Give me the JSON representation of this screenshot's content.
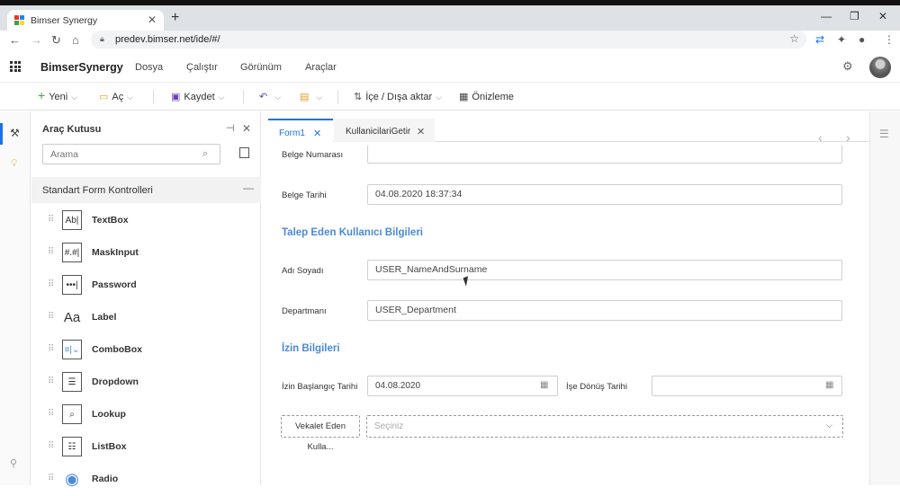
{
  "browser": {
    "tab_title": "Bimser Synergy",
    "url": "predev.bimser.net/ide/#/"
  },
  "app": {
    "brand": "BimserSynergy",
    "menu": [
      "Dosya",
      "Çalıştır",
      "Görünüm",
      "Araçlar"
    ]
  },
  "toolbar": {
    "new_label": "Yeni",
    "open_label": "Aç",
    "save_label": "Kaydet",
    "import_export_label": "İçe / Dışa aktar",
    "preview_label": "Önizleme"
  },
  "toolbox": {
    "title": "Araç Kutusu",
    "search_placeholder": "Arama",
    "section_title": "Standart Form Kontrolleri",
    "items": [
      {
        "name": "TextBox",
        "icon": "textbox-icon",
        "glyph": "Ab|"
      },
      {
        "name": "MaskInput",
        "icon": "maskinput-icon",
        "glyph": "#.#|"
      },
      {
        "name": "Password",
        "icon": "password-icon",
        "glyph": "•••|"
      },
      {
        "name": "Label",
        "icon": "label-icon",
        "glyph": "Aa"
      },
      {
        "name": "ComboBox",
        "icon": "combobox-icon",
        "glyph": "≡|⌄"
      },
      {
        "name": "Dropdown",
        "icon": "dropdown-icon",
        "glyph": "☰"
      },
      {
        "name": "Lookup",
        "icon": "lookup-icon",
        "glyph": "⌕"
      },
      {
        "name": "ListBox",
        "icon": "listbox-icon",
        "glyph": "☷"
      },
      {
        "name": "Radio",
        "icon": "radio-icon",
        "glyph": "◉"
      }
    ]
  },
  "editor": {
    "tabs": [
      {
        "label": "Form1"
      },
      {
        "label": "KullanicilariGetir"
      }
    ],
    "fields": {
      "belge_numarasi": {
        "label": "Belge Numarası",
        "value": ""
      },
      "belge_tarihi": {
        "label": "Belge Tarihi",
        "value": "04.08.2020 18:37:34"
      },
      "section_talep": "Talep Eden Kullanıcı Bilgileri",
      "adi_soyadi": {
        "label": "Adı Soyadı",
        "value": "USER_NameAndSurname"
      },
      "departmani": {
        "label": "Departmanı",
        "value": "USER_Department"
      },
      "section_izin": "İzin Bilgileri",
      "izin_baslangic": {
        "label": "İzin Başlangıç Tarihi",
        "value": "04.08.2020"
      },
      "ise_donus": {
        "label": "İşe Dönüş Tarihi",
        "value": ""
      },
      "vekalet": {
        "label": "Vekalet Eden Kulla...",
        "placeholder": "Seçiniz"
      }
    }
  }
}
